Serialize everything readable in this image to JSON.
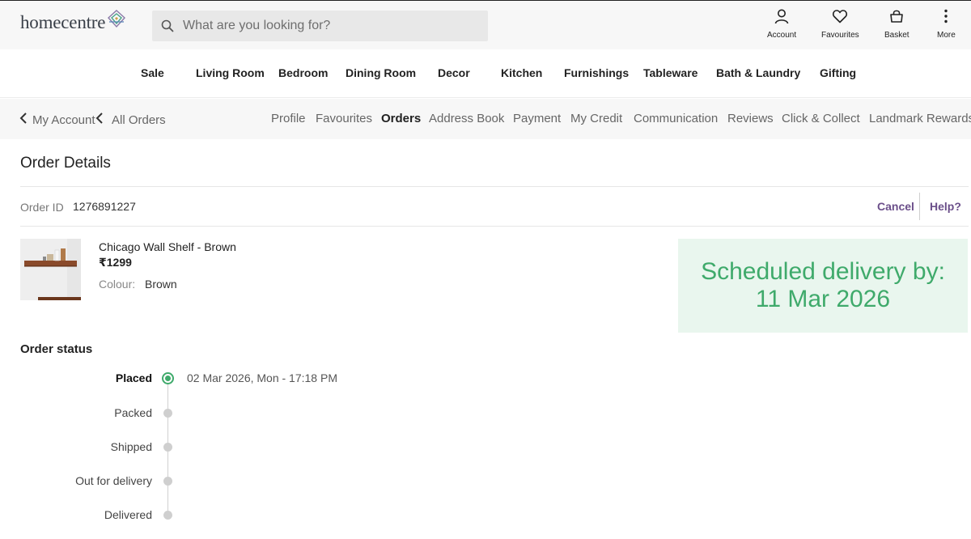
{
  "header": {
    "logo_text": "homecentre",
    "search": {
      "placeholder": "What are you looking for?"
    },
    "icons": [
      {
        "label": "Account",
        "icon": "user-icon"
      },
      {
        "label": "Favourites",
        "icon": "heart-icon"
      },
      {
        "label": "Basket",
        "icon": "basket-icon"
      },
      {
        "label": "More",
        "icon": "more-vertical-icon"
      }
    ]
  },
  "categories": [
    "Sale",
    "Living Room",
    "Bedroom",
    "Dining Room",
    "Decor",
    "Kitchen",
    "Furnishings",
    "Tableware",
    "Bath & Laundry",
    "Gifting"
  ],
  "account_nav": {
    "breadcrumbs": [
      "My Account",
      "All Orders"
    ],
    "tabs": [
      {
        "label": "Profile",
        "active": false
      },
      {
        "label": "Favourites",
        "active": false
      },
      {
        "label": "Orders",
        "active": true
      },
      {
        "label": "Address Book",
        "active": false
      },
      {
        "label": "Payment",
        "active": false
      },
      {
        "label": "My Credit",
        "active": false
      },
      {
        "label": "Communication",
        "active": false
      },
      {
        "label": "Reviews",
        "active": false
      },
      {
        "label": "Click & Collect",
        "active": false
      },
      {
        "label": "Landmark Rewards",
        "active": false
      }
    ]
  },
  "order": {
    "title": "Order Details",
    "id_label": "Order ID",
    "id_value": "1276891227",
    "cancel_label": "Cancel",
    "help_label": "Help?",
    "product": {
      "name": "Chicago Wall Shelf - Brown",
      "price": "₹1299",
      "colour_label": "Colour:",
      "colour_value": "Brown"
    },
    "delivery": {
      "line1": "Scheduled delivery by:",
      "line2": "11 Mar 2026"
    },
    "status_title": "Order status",
    "steps": [
      {
        "label": "Placed",
        "done": true,
        "time": "02 Mar 2026, Mon - 17:18 PM"
      },
      {
        "label": "Packed",
        "done": false
      },
      {
        "label": "Shipped",
        "done": false
      },
      {
        "label": "Out for delivery",
        "done": false
      },
      {
        "label": "Delivered",
        "done": false
      }
    ]
  },
  "colors": {
    "accent_green": "#3faa6b",
    "link_purple": "#6b4f8a",
    "delivery_bg": "#e9f6ee"
  }
}
